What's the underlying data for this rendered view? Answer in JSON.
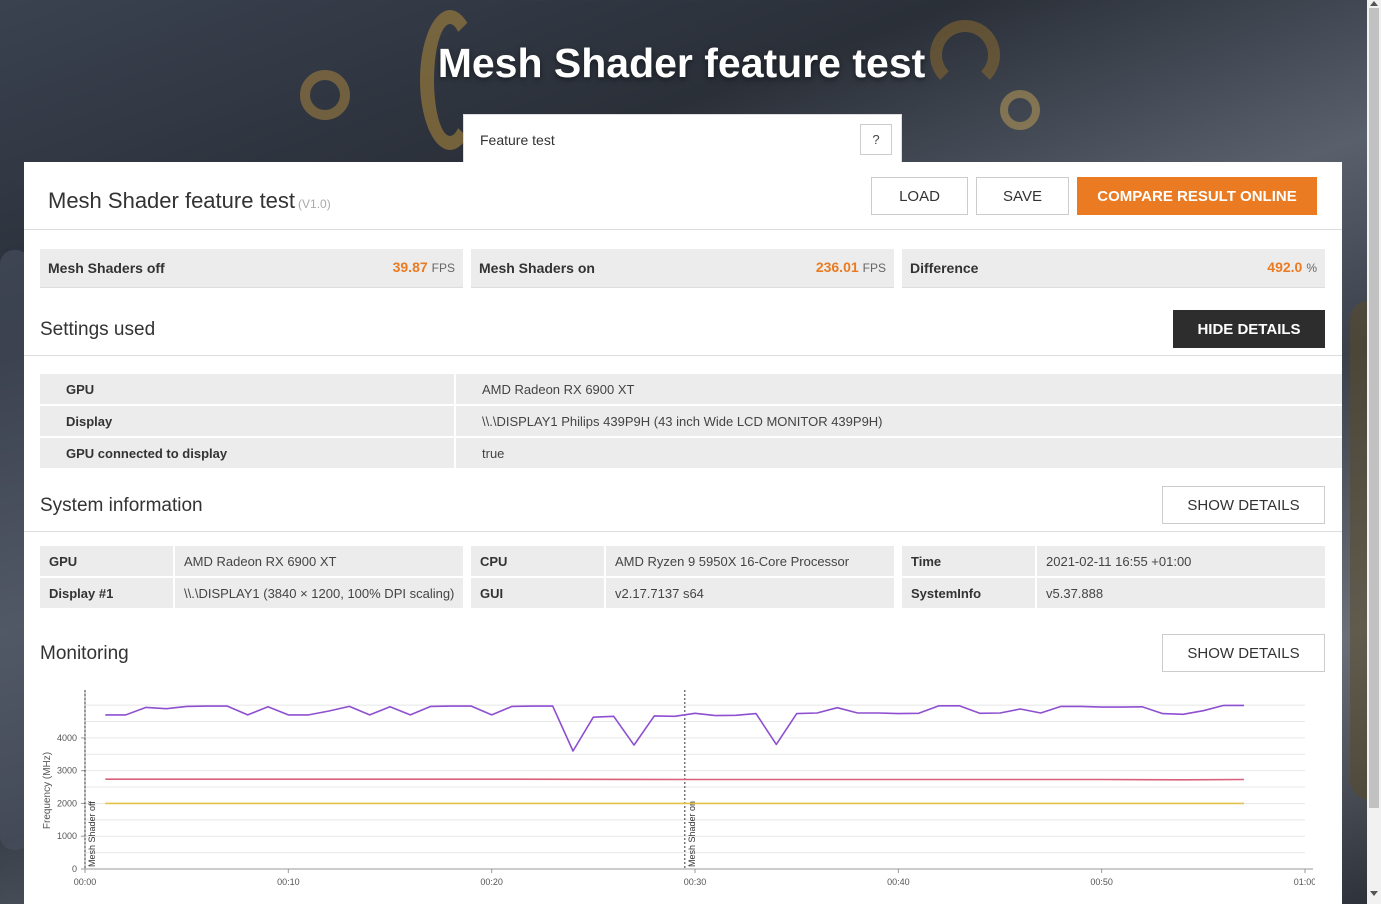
{
  "page_title": "Mesh Shader feature test",
  "feature_tab": {
    "label": "Feature test",
    "help": "?"
  },
  "header": {
    "title": "Mesh Shader feature test",
    "version": "(V1.0)",
    "load_label": "LOAD",
    "save_label": "SAVE",
    "compare_label": "COMPARE RESULT ONLINE"
  },
  "scores": [
    {
      "label": "Mesh Shaders off",
      "value": "39.87",
      "unit": "FPS"
    },
    {
      "label": "Mesh Shaders on",
      "value": "236.01",
      "unit": "FPS"
    },
    {
      "label": "Difference",
      "value": "492.0",
      "unit": "%"
    }
  ],
  "settings": {
    "title": "Settings used",
    "button": "HIDE DETAILS",
    "rows": [
      {
        "key": "GPU",
        "value": "AMD Radeon RX 6900 XT"
      },
      {
        "key": "Display",
        "value": "\\\\.\\DISPLAY1 Philips 439P9H (43 inch Wide LCD MONITOR 439P9H)"
      },
      {
        "key": "GPU connected to display",
        "value": "true"
      }
    ]
  },
  "system": {
    "title": "System information",
    "button": "SHOW DETAILS",
    "cells": [
      {
        "key": "GPU",
        "value": "AMD Radeon RX 6900 XT"
      },
      {
        "key": "CPU",
        "value": "AMD Ryzen 9 5950X 16-Core Processor"
      },
      {
        "key": "Time",
        "value": "2021-02-11 16:55 +01:00"
      },
      {
        "key": "Display #1",
        "value": "\\\\.\\DISPLAY1 (3840 × 1200, 100% DPI scaling)"
      },
      {
        "key": "GUI",
        "value": "v2.17.7137 s64"
      },
      {
        "key": "SystemInfo",
        "value": "v5.37.888"
      }
    ]
  },
  "monitoring": {
    "title": "Monitoring",
    "button": "SHOW DETAILS"
  },
  "colors": {
    "accent": "#ea7b22",
    "gpu_clock": "#8e4fd0",
    "cpu_clock": "#d9607a",
    "memory_clock": "#e2c24a"
  },
  "chart_data": {
    "type": "line",
    "ylabel": "Frequency (MHz)",
    "xlim": [
      0,
      60
    ],
    "ylim": [
      0,
      5400
    ],
    "yticks": [
      0,
      1000,
      2000,
      3000,
      4000
    ],
    "ytick_labels": [
      "0",
      "1000",
      "2000",
      "3000",
      "4000"
    ],
    "xticks": [
      0,
      10,
      20,
      30,
      40,
      50,
      60
    ],
    "xtick_labels": [
      "00:00",
      "00:10",
      "00:20",
      "00:30",
      "00:40",
      "00:50",
      "01:00"
    ],
    "markers": [
      {
        "x": 0,
        "label": "Mesh Shader off"
      },
      {
        "x": 29.5,
        "label": "Mesh Shader on"
      }
    ],
    "series": [
      {
        "color": "#8e4fd0",
        "x": [
          1,
          2,
          3,
          4,
          5,
          6,
          7,
          8,
          9,
          10,
          11,
          12,
          13,
          14,
          15,
          16,
          17,
          18,
          19,
          20,
          21,
          22,
          23,
          24,
          25,
          26,
          27,
          28,
          29,
          30,
          31,
          32,
          33,
          34,
          35,
          36,
          37,
          38,
          39,
          40,
          41,
          42,
          43,
          44,
          45,
          46,
          47,
          48,
          49,
          50,
          51,
          52,
          53,
          54,
          55,
          56,
          57
        ],
        "values": [
          4700,
          4700,
          4930,
          4890,
          4960,
          4970,
          4970,
          4700,
          4950,
          4700,
          4700,
          4820,
          4960,
          4700,
          4950,
          4700,
          4960,
          4970,
          4970,
          4700,
          4960,
          4970,
          4970,
          3600,
          4630,
          4660,
          3780,
          4670,
          4660,
          4750,
          4680,
          4690,
          4740,
          3800,
          4740,
          4760,
          4920,
          4760,
          4760,
          4740,
          4750,
          4980,
          4980,
          4750,
          4760,
          4880,
          4760,
          4960,
          4960,
          4940,
          4940,
          4950,
          4740,
          4720,
          4830,
          4990,
          4990
        ]
      },
      {
        "color": "#d9607a",
        "x": [
          1,
          10,
          20,
          30,
          40,
          50,
          54,
          57
        ],
        "values": [
          2740,
          2740,
          2740,
          2730,
          2730,
          2730,
          2720,
          2730
        ]
      },
      {
        "color": "#e2c24a",
        "x": [
          1,
          10,
          20,
          30,
          40,
          50,
          57
        ],
        "values": [
          2000,
          2000,
          2000,
          2000,
          2000,
          2000,
          2000
        ]
      }
    ]
  }
}
